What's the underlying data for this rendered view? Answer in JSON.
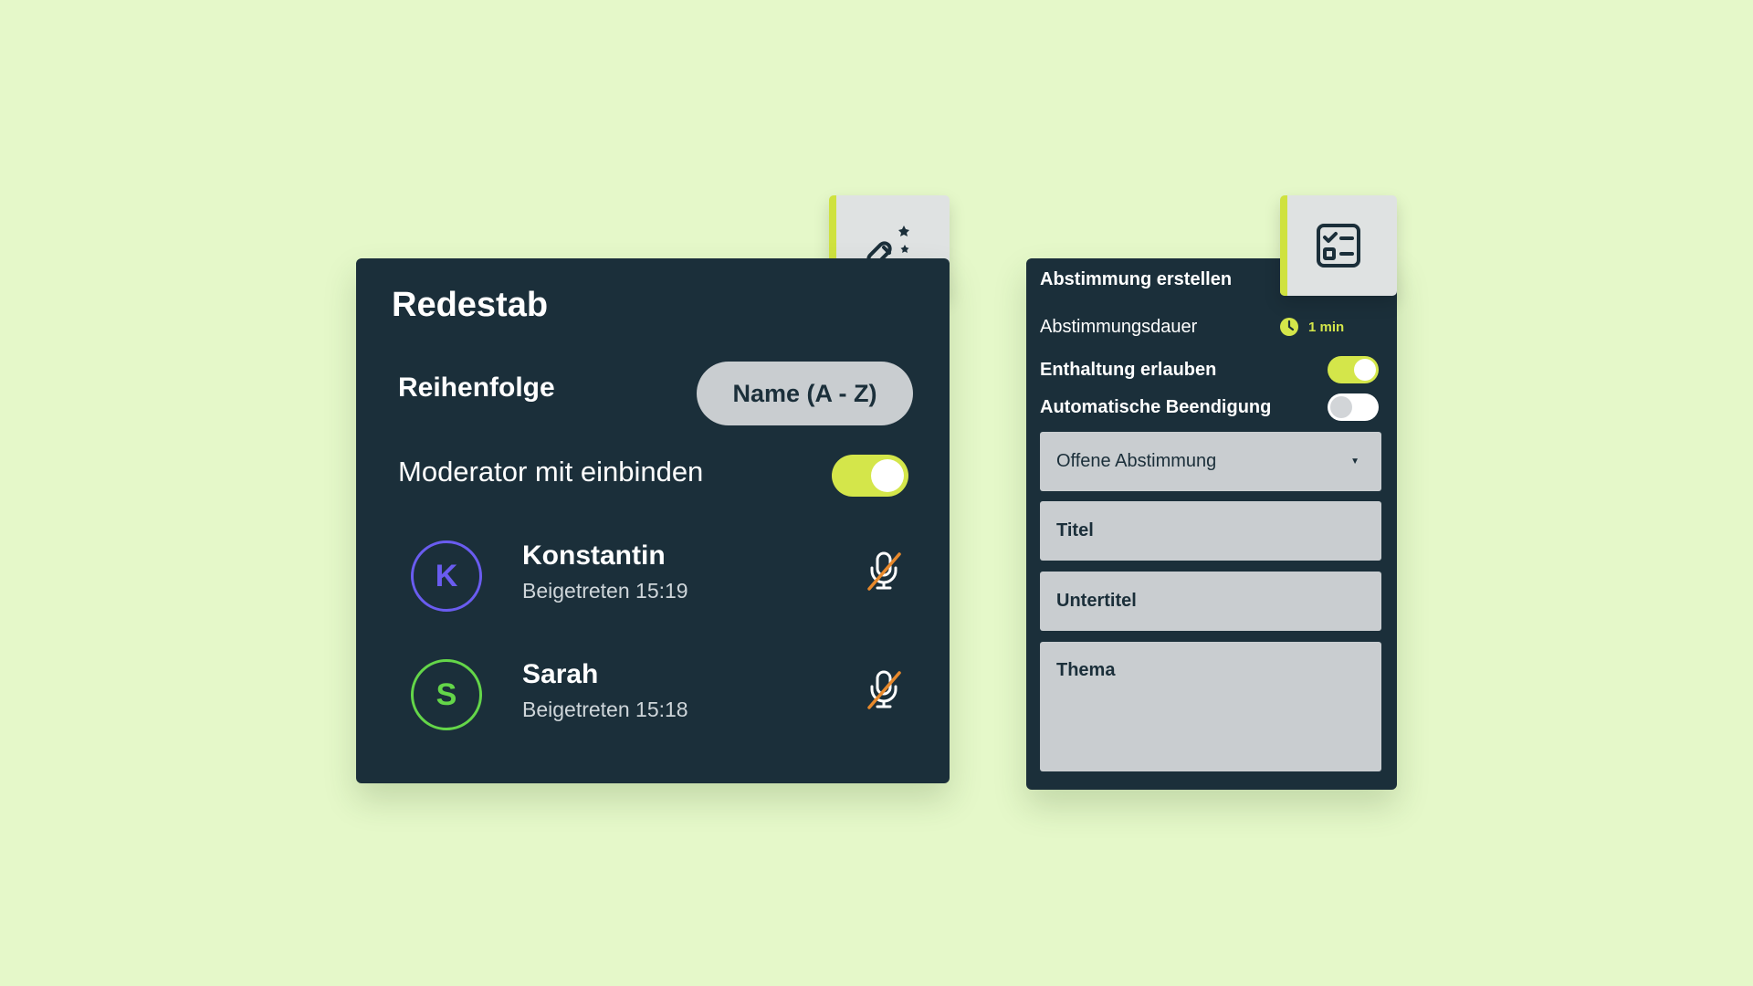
{
  "speaking_panel": {
    "title": "Redestab",
    "order_label": "Reihenfolge",
    "order_value": "Name (A - Z)",
    "moderator_label": "Moderator mit einbinden",
    "moderator_enabled": true,
    "tab_icon": "magic-wand-icon",
    "participants": [
      {
        "initial": "K",
        "name": "Konstantin",
        "joined": "Beigetreten 15:19",
        "color": "#6a5cf0",
        "mic_icon": "mic-muted-icon"
      },
      {
        "initial": "S",
        "name": "Sarah",
        "joined": "Beigetreten 15:18",
        "color": "#64d649",
        "mic_icon": "mic-muted-icon"
      }
    ]
  },
  "poll_panel": {
    "title": "Abstimmung erstellen",
    "tab_icon": "checklist-icon",
    "duration_label": "Abstimmungsdauer",
    "duration_value": "1 min",
    "abstain_label": "Enthaltung erlauben",
    "abstain_enabled": true,
    "auto_end_label": "Automatische Beendigung",
    "auto_end_enabled": false,
    "poll_type": "Offene Abstimmung",
    "title_placeholder": "Titel",
    "subtitle_placeholder": "Untertitel",
    "topic_placeholder": "Thema"
  },
  "colors": {
    "background": "#e5f8c9",
    "panel": "#1b2f3a",
    "accent": "#d4e64a",
    "field": "#c9cdd0",
    "mute_slash": "#e8892b"
  }
}
